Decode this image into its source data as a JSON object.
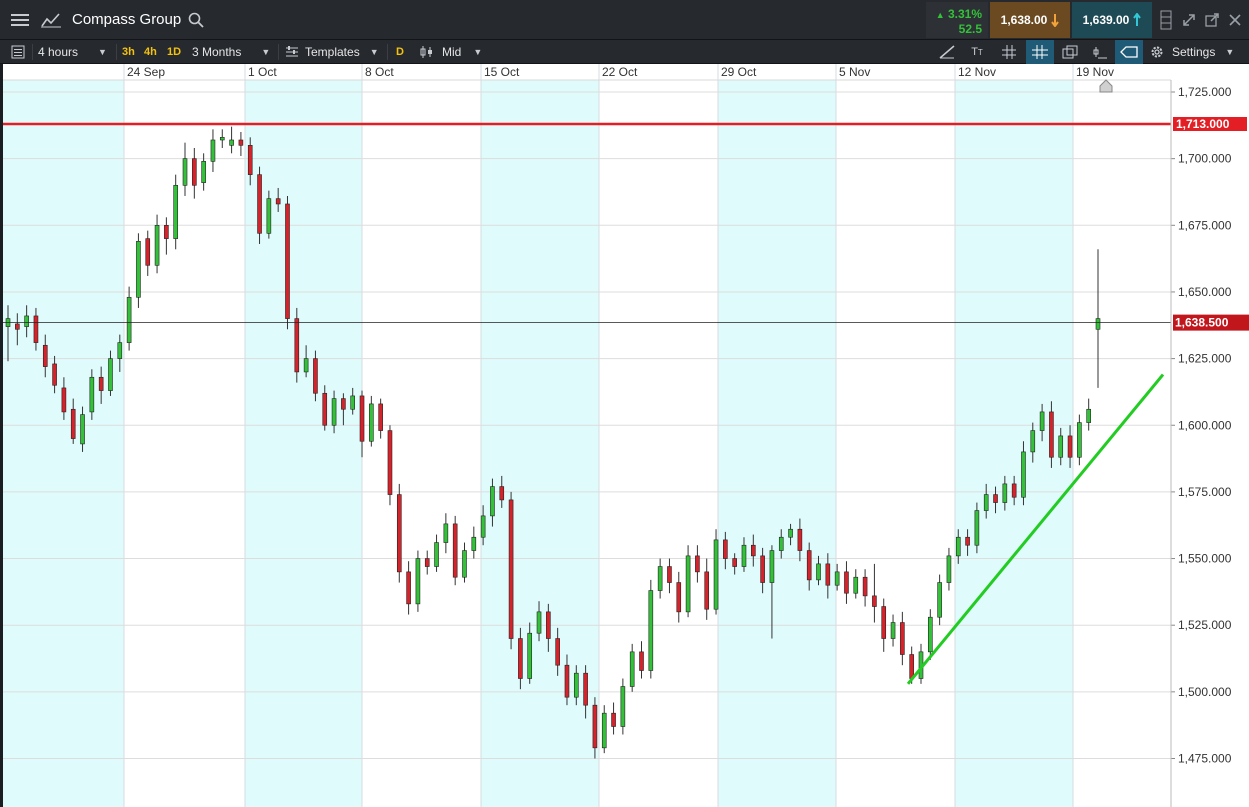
{
  "header": {
    "instrument": "Compass Group",
    "change_pct": "3.31%",
    "change_pts": "52.5",
    "sell": "1,638.00",
    "buy": "1,639.00"
  },
  "toolbar": {
    "interval": "4 hours",
    "presets": [
      "3h",
      "4h",
      "1D"
    ],
    "range": "3 Months",
    "templates": "Templates",
    "day_mode": "D",
    "price_type": "Mid",
    "settings": "Settings"
  },
  "icons": [
    "menu-icon",
    "line-chart-icon",
    "search-icon",
    "arrow-down-icon",
    "arrow-up-icon",
    "dock-icon",
    "expand-icon",
    "popout-icon",
    "close-icon",
    "list-icon",
    "templates-icon",
    "candle-icon",
    "draw-icon",
    "text-icon",
    "grid-icon",
    "crosshair-icon",
    "layers-icon",
    "indicator-icon",
    "price-tag-icon",
    "gear-icon"
  ],
  "colors": {
    "up": "#34c13a",
    "down": "#d6232b",
    "shade": "#e0fbfc",
    "hline": "#e31e24",
    "trend": "#22cc22"
  },
  "chart_data": {
    "type": "candlestick",
    "title": "Compass Group",
    "x_labels": [
      "24 Sep",
      "1 Oct",
      "8 Oct",
      "15 Oct",
      "22 Oct",
      "29 Oct",
      "5 Nov",
      "12 Nov",
      "19 Nov"
    ],
    "y_ticks": [
      "1,725.000",
      "1,700.000",
      "1,675.000",
      "1,650.000",
      "1,625.000",
      "1,600.000",
      "1,575.000",
      "1,550.000",
      "1,525.000",
      "1,500.000",
      "1,475.000"
    ],
    "ylim": [
      1465,
      1730
    ],
    "resistance_level": "1,713.000",
    "current_price": "1,638.500",
    "trendline": [
      [
        1503,
        "5 Nov"
      ],
      [
        1619,
        "19 Nov"
      ]
    ],
    "candles": [
      [
        1637,
        1640,
        1624,
        1645
      ],
      [
        1638,
        1636,
        1630,
        1642
      ],
      [
        1637,
        1641,
        1633,
        1645
      ],
      [
        1641,
        1631,
        1628,
        1644
      ],
      [
        1630,
        1622,
        1618,
        1634
      ],
      [
        1623,
        1615,
        1612,
        1626
      ],
      [
        1614,
        1605,
        1602,
        1618
      ],
      [
        1606,
        1595,
        1593,
        1610
      ],
      [
        1593,
        1604,
        1590,
        1607
      ],
      [
        1605,
        1618,
        1602,
        1621
      ],
      [
        1618,
        1613,
        1608,
        1622
      ],
      [
        1613,
        1625,
        1611,
        1628
      ],
      [
        1625,
        1631,
        1620,
        1634
      ],
      [
        1631,
        1648,
        1628,
        1652
      ],
      [
        1648,
        1669,
        1644,
        1672
      ],
      [
        1670,
        1660,
        1656,
        1673
      ],
      [
        1660,
        1675,
        1657,
        1679
      ],
      [
        1675,
        1670,
        1664,
        1678
      ],
      [
        1670,
        1690,
        1666,
        1694
      ],
      [
        1690,
        1700,
        1686,
        1706
      ],
      [
        1700,
        1690,
        1685,
        1704
      ],
      [
        1691,
        1699,
        1688,
        1702
      ],
      [
        1699,
        1707,
        1695,
        1711
      ],
      [
        1707,
        1708,
        1704,
        1711
      ],
      [
        1705,
        1707,
        1702,
        1712
      ],
      [
        1707,
        1705,
        1701,
        1710
      ],
      [
        1705,
        1694,
        1690,
        1708
      ],
      [
        1694,
        1672,
        1668,
        1697
      ],
      [
        1672,
        1685,
        1670,
        1688
      ],
      [
        1685,
        1683,
        1680,
        1689
      ],
      [
        1683,
        1640,
        1636,
        1686
      ],
      [
        1640,
        1620,
        1616,
        1644
      ],
      [
        1620,
        1625,
        1618,
        1630
      ],
      [
        1625,
        1612,
        1609,
        1628
      ],
      [
        1612,
        1600,
        1598,
        1615
      ],
      [
        1600,
        1610,
        1597,
        1613
      ],
      [
        1610,
        1606,
        1600,
        1612
      ],
      [
        1606,
        1611,
        1604,
        1614
      ],
      [
        1611,
        1594,
        1588,
        1613
      ],
      [
        1594,
        1608,
        1592,
        1611
      ],
      [
        1608,
        1598,
        1595,
        1610
      ],
      [
        1598,
        1574,
        1570,
        1600
      ],
      [
        1574,
        1545,
        1541,
        1578
      ],
      [
        1545,
        1533,
        1529,
        1549
      ],
      [
        1533,
        1550,
        1530,
        1553
      ],
      [
        1550,
        1547,
        1544,
        1553
      ],
      [
        1547,
        1556,
        1545,
        1559
      ],
      [
        1556,
        1563,
        1552,
        1567
      ],
      [
        1563,
        1543,
        1540,
        1566
      ],
      [
        1543,
        1553,
        1541,
        1556
      ],
      [
        1553,
        1558,
        1550,
        1562
      ],
      [
        1558,
        1566,
        1555,
        1570
      ],
      [
        1566,
        1577,
        1562,
        1580
      ],
      [
        1577,
        1572,
        1569,
        1581
      ],
      [
        1572,
        1520,
        1516,
        1575
      ],
      [
        1520,
        1505,
        1501,
        1524
      ],
      [
        1505,
        1522,
        1503,
        1526
      ],
      [
        1522,
        1530,
        1519,
        1534
      ],
      [
        1530,
        1520,
        1515,
        1533
      ],
      [
        1520,
        1510,
        1506,
        1524
      ],
      [
        1510,
        1498,
        1495,
        1514
      ],
      [
        1498,
        1507,
        1495,
        1510
      ],
      [
        1507,
        1495,
        1490,
        1510
      ],
      [
        1495,
        1479,
        1475,
        1498
      ],
      [
        1479,
        1492,
        1477,
        1495
      ],
      [
        1492,
        1487,
        1484,
        1496
      ],
      [
        1487,
        1502,
        1484,
        1505
      ],
      [
        1502,
        1515,
        1500,
        1518
      ],
      [
        1515,
        1508,
        1505,
        1519
      ],
      [
        1508,
        1538,
        1505,
        1542
      ],
      [
        1538,
        1547,
        1535,
        1550
      ],
      [
        1547,
        1541,
        1537,
        1550
      ],
      [
        1541,
        1530,
        1526,
        1545
      ],
      [
        1530,
        1551,
        1528,
        1555
      ],
      [
        1551,
        1545,
        1541,
        1555
      ],
      [
        1545,
        1531,
        1527,
        1550
      ],
      [
        1531,
        1557,
        1529,
        1561
      ],
      [
        1557,
        1550,
        1546,
        1560
      ],
      [
        1550,
        1547,
        1544,
        1552
      ],
      [
        1547,
        1555,
        1545,
        1558
      ],
      [
        1555,
        1551,
        1547,
        1559
      ],
      [
        1551,
        1541,
        1537,
        1554
      ],
      [
        1541,
        1553,
        1520,
        1555
      ],
      [
        1553,
        1558,
        1550,
        1561
      ],
      [
        1558,
        1561,
        1555,
        1563
      ],
      [
        1561,
        1553,
        1549,
        1565
      ],
      [
        1553,
        1542,
        1538,
        1556
      ],
      [
        1542,
        1548,
        1540,
        1551
      ],
      [
        1548,
        1540,
        1535,
        1552
      ],
      [
        1540,
        1545,
        1538,
        1548
      ],
      [
        1545,
        1537,
        1533,
        1549
      ],
      [
        1537,
        1543,
        1535,
        1546
      ],
      [
        1543,
        1536,
        1532,
        1546
      ],
      [
        1536,
        1532,
        1526,
        1548
      ],
      [
        1532,
        1520,
        1515,
        1535
      ],
      [
        1520,
        1526,
        1517,
        1529
      ],
      [
        1526,
        1514,
        1510,
        1530
      ],
      [
        1514,
        1505,
        1503,
        1517
      ],
      [
        1505,
        1515,
        1503,
        1518
      ],
      [
        1515,
        1528,
        1512,
        1531
      ],
      [
        1528,
        1541,
        1525,
        1544
      ],
      [
        1541,
        1551,
        1538,
        1554
      ],
      [
        1551,
        1558,
        1548,
        1561
      ],
      [
        1558,
        1555,
        1551,
        1561
      ],
      [
        1555,
        1568,
        1552,
        1571
      ],
      [
        1568,
        1574,
        1565,
        1578
      ],
      [
        1574,
        1571,
        1567,
        1577
      ],
      [
        1571,
        1578,
        1568,
        1581
      ],
      [
        1578,
        1573,
        1570,
        1581
      ],
      [
        1573,
        1590,
        1570,
        1594
      ],
      [
        1590,
        1598,
        1586,
        1601
      ],
      [
        1598,
        1605,
        1594,
        1608
      ],
      [
        1605,
        1588,
        1584,
        1609
      ],
      [
        1588,
        1596,
        1585,
        1599
      ],
      [
        1596,
        1588,
        1584,
        1600
      ],
      [
        1588,
        1601,
        1585,
        1604
      ],
      [
        1601,
        1606,
        1598,
        1610
      ],
      [
        1636,
        1640,
        1614,
        1666
      ]
    ]
  }
}
